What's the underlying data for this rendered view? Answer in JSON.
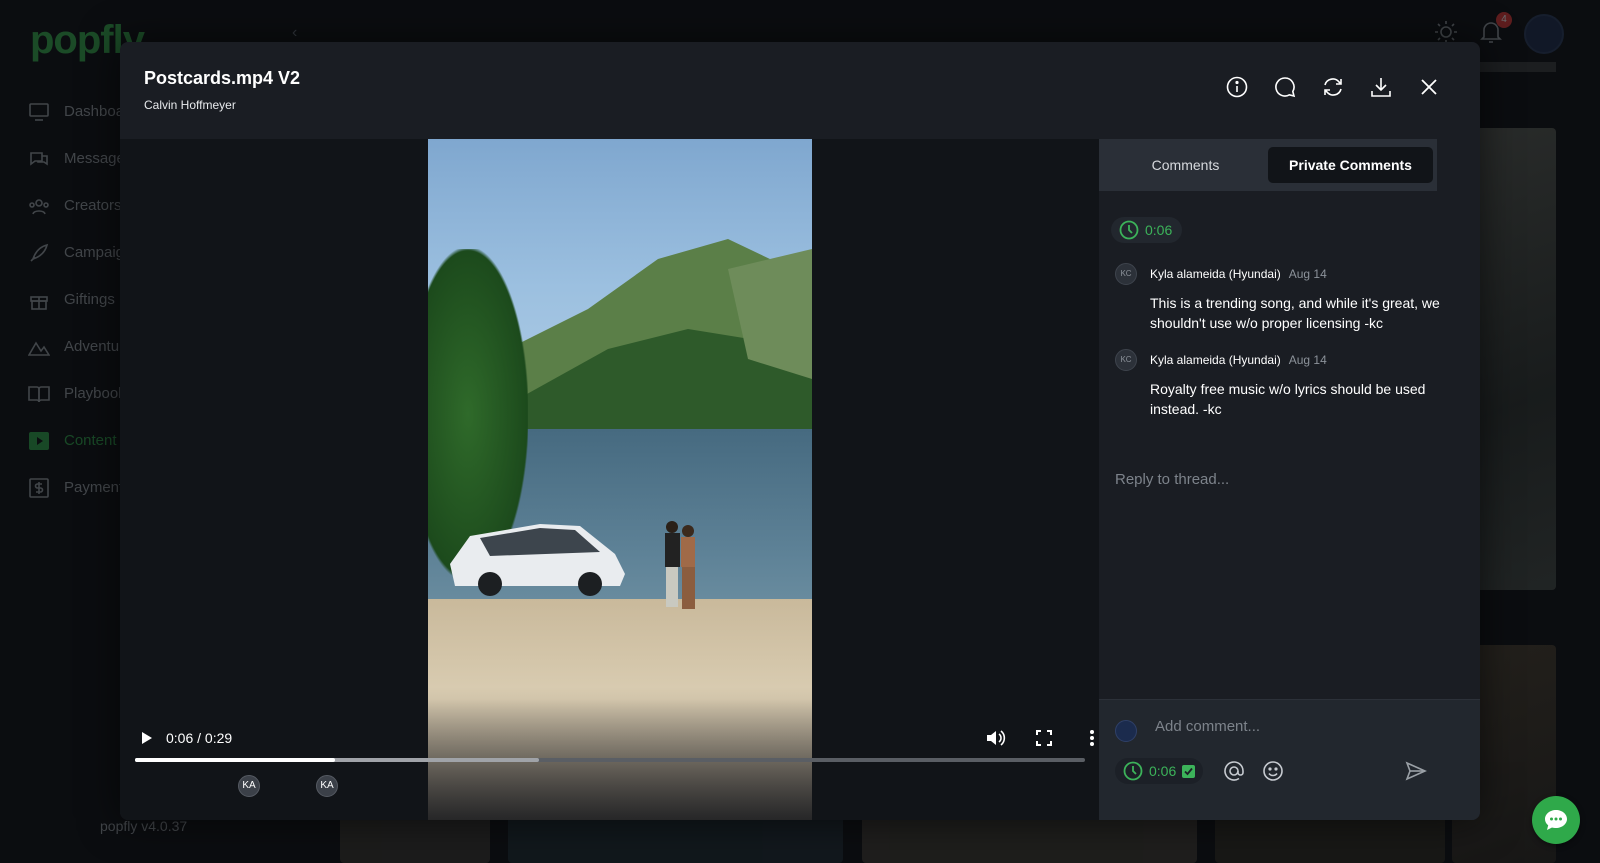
{
  "background_app": {
    "logo": "popfly",
    "nav": [
      {
        "label": "Dashboard",
        "icon": "monitor-icon"
      },
      {
        "label": "Messages",
        "icon": "messages-icon"
      },
      {
        "label": "Creators",
        "icon": "creators-icon"
      },
      {
        "label": "Campaigns",
        "icon": "rocket-icon"
      },
      {
        "label": "Giftings",
        "icon": "gift-icon"
      },
      {
        "label": "Adventures",
        "icon": "mountain-icon"
      },
      {
        "label": "Playbooks",
        "icon": "book-icon"
      },
      {
        "label": "Content",
        "icon": "play-icon",
        "active": true
      },
      {
        "label": "Payments",
        "icon": "dollar-icon"
      }
    ],
    "version": "popfly v4.0.37",
    "notification_count": "4"
  },
  "modal": {
    "title": "Postcards.mp4 V2",
    "subtitle": "Calvin Hoffmeyer",
    "actions": [
      "info-icon",
      "comment-icon",
      "refresh-icon",
      "download-icon",
      "close-icon"
    ]
  },
  "video": {
    "time": "0:06 / 0:29",
    "progress_fraction": 0.21,
    "buffered_fraction": 0.425,
    "markers": [
      {
        "initials": "KA"
      },
      {
        "initials": "KA"
      }
    ]
  },
  "comments": {
    "tabs": [
      "Comments",
      "Private Comments"
    ],
    "active_tab": "Private Comments",
    "thread_timestamp": "0:06",
    "items": [
      {
        "avatar": "KC",
        "author": "Kyla alameida (Hyundai)",
        "date": "Aug 14",
        "text": "This is a trending song, and while it's great, we shouldn't use w/o proper licensing -kc"
      },
      {
        "avatar": "KC",
        "author": "Kyla alameida (Hyundai)",
        "date": "Aug 14",
        "text": "Royalty free music w/o lyrics should be used instead. -kc"
      }
    ],
    "reply_placeholder": "Reply to thread...",
    "composer": {
      "placeholder": "Add comment...",
      "timestamp": "0:06",
      "timestamp_checked": true
    }
  },
  "colors": {
    "accent_green": "#3cb35a",
    "modal_bg": "#1a1d23",
    "fab_green": "#2fa94a"
  }
}
